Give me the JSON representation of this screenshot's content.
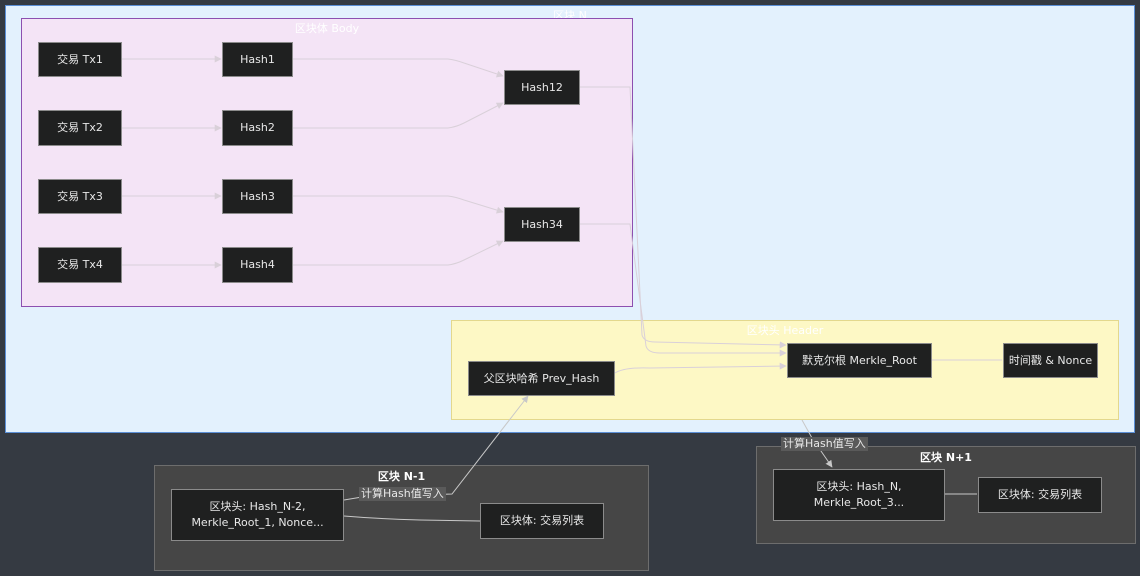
{
  "clusters": {
    "block_n": "区块 N",
    "body": "区块体 Body",
    "header": "区块头 Header",
    "block_n_minus_1": "区块 N-1",
    "block_n_plus_1": "区块 N+1"
  },
  "nodes": {
    "tx1": "交易 Tx1",
    "tx2": "交易 Tx2",
    "tx3": "交易 Tx3",
    "tx4": "交易 Tx4",
    "hash1": "Hash1",
    "hash2": "Hash2",
    "hash3": "Hash3",
    "hash4": "Hash4",
    "hash12": "Hash12",
    "hash34": "Hash34",
    "prev_hash": "父区块哈希 Prev_Hash",
    "merkle_root": "默克尔根 Merkle_Root",
    "timestamp_nonce": "时间戳 & Nonce",
    "prev_header": "区块头: Hash_N-2,\nMerkle_Root_1, Nonce...",
    "prev_body": "区块体: 交易列表",
    "next_header": "区块头: Hash_N,\nMerkle_Root_3...",
    "next_body": "区块体: 交易列表"
  },
  "edge_labels": {
    "prev_to_current": "计算Hash值写入",
    "current_to_next": "计算Hash值写入"
  },
  "colors": {
    "edge_light": "#d9d0d9",
    "edge_dark": "#c8c8c8"
  }
}
